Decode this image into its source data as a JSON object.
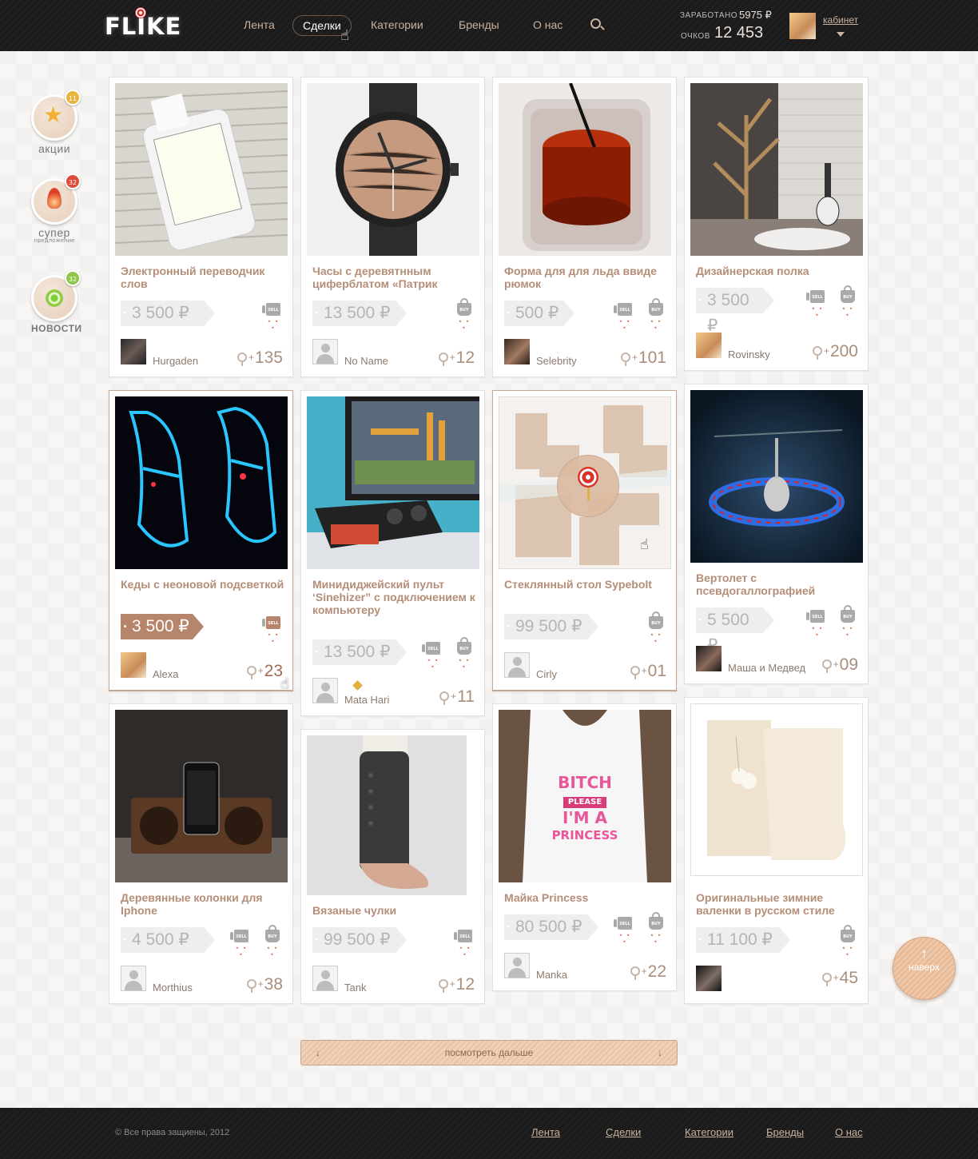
{
  "header": {
    "logo": "FLIKE",
    "nav": [
      "Лента",
      "Сделки",
      "Категории",
      "Бренды",
      "О нас"
    ],
    "earned_label": "ЗАРАБОТАНО",
    "earned_value": "5975 ₽",
    "points_label": "ОЧКОВ",
    "points_value": "12 453",
    "cabinet": "кабинет"
  },
  "sidebar": [
    {
      "label": "акции",
      "badge": "11"
    },
    {
      "label": "супер",
      "sub": "предложение",
      "badge": "32"
    },
    {
      "label": "НОВОСТИ",
      "badge": "32"
    }
  ],
  "cards": [
    {
      "title": "Электронный переводчик слов",
      "price": "3 500 ₽",
      "user": "Hurgaden",
      "score": "135"
    },
    {
      "title": "Часы с деревятнным циферблатом «Патрик",
      "price": "13 500 ₽",
      "user": "No Name",
      "score": "12"
    },
    {
      "title": "Форма для для льда ввиде рюмок",
      "price": "500 ₽",
      "user": "Selebrity",
      "score": "101"
    },
    {
      "title": "Дизайнерская полка",
      "price": "3 500 ₽",
      "user": "Rovinsky",
      "score": "200"
    },
    {
      "title": "Кеды с неоновой подсветкой",
      "price": "3 500 ₽",
      "user": "Alexa",
      "score": "23"
    },
    {
      "title": "Минидиджейский пульт ‘Sinehizer” с подключением к компьютеру",
      "price": "13 500 ₽",
      "user": "Mata Hari",
      "score": "11"
    },
    {
      "title": "Стеклянный стол Sypebolt",
      "price": "99 500 ₽",
      "user": "Cirly",
      "score": "01"
    },
    {
      "title": "Вертолет с псевдогаллографией",
      "price": "5 500 ₽",
      "user": "Маша и Медвед",
      "score": "09"
    },
    {
      "title": "Деревянные колонки для Iphone",
      "price": "4 500 ₽",
      "user": "Morthius",
      "score": "38"
    },
    {
      "title": "Вязаные чулки",
      "price": "99 500 ₽",
      "user": "Tank",
      "score": "12"
    },
    {
      "title": "Майка Princess",
      "price": "80 500 ₽",
      "user": "Manka",
      "score": "22"
    },
    {
      "title": "Оригинальные зимние валенки в русском стиле",
      "price": "11 100 ₽",
      "user": "",
      "score": "45"
    }
  ],
  "shirt_text": [
    "BITCH",
    "PLEASE",
    "I'M A",
    "PRINCESS"
  ],
  "icons": {
    "sell": "SELL",
    "buy": "BUY",
    "dots": "• • •",
    "plus": "+"
  },
  "load_more": "посмотреть дальше",
  "top_button": "наверх",
  "footer": {
    "copyright": "© Все права защиены, 2012",
    "nav": [
      "Лента",
      "Сделки",
      "Категории",
      "Бренды",
      "О нас"
    ]
  }
}
